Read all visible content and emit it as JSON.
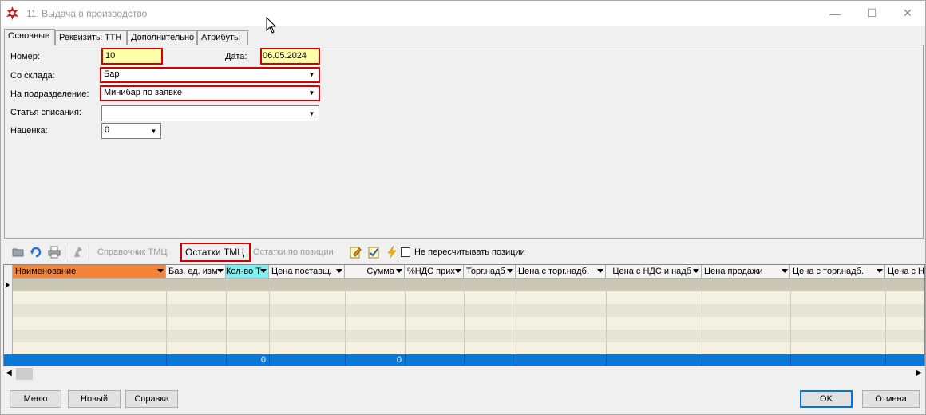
{
  "window": {
    "title": "11. Выдача в производство",
    "minimize": "—",
    "maximize": "☐",
    "close": "✕"
  },
  "tabs": [
    "Основные",
    "Реквизиты ТТН",
    "Дополнительно",
    "Атрибуты"
  ],
  "form": {
    "number_label": "Номер:",
    "number_value": "10",
    "date_label": "Дата:",
    "date_value": "06.05.2024",
    "warehouse_label": "Со склада:",
    "warehouse_value": "Бар",
    "department_label": "На подразделение:",
    "department_value": "Минибар по заявке",
    "writeoff_label": "Статья списания:",
    "writeoff_value": "",
    "markup_label": "Наценка:",
    "markup_value": "0"
  },
  "toolbar": {
    "catalog_label": "Справочник ТМЦ",
    "stock_label": "Остатки ТМЦ",
    "stock_by_position_label": "Остатки по позиции",
    "no_recalc_label": "Не пересчитывать позиции",
    "no_recalc_checked": false
  },
  "grid": {
    "columns": [
      "Наименование",
      "Баз. ед. изм",
      "Кол-во Т",
      "Цена поставщ.",
      "Сумма",
      "%НДС прих",
      "Торг.надб",
      "Цена с торг.надб.",
      "Цена с НДС и надб",
      "Цена продажи",
      "Цена с торг.надб.",
      "Цена с НД"
    ],
    "footer": {
      "qty_total": "0",
      "sum_total": "0"
    }
  },
  "buttons": {
    "menu": "Меню",
    "new": "Новый",
    "help": "Справка",
    "ok": "OK",
    "cancel": "Отмена"
  },
  "colors": {
    "name_header": "#f5843b",
    "qty_header": "#80f0f0",
    "highlight": "#d40000",
    "footer_row": "#0a78d7",
    "row_odd": "#c9c6b4",
    "row_even": "#f4f0e2"
  }
}
